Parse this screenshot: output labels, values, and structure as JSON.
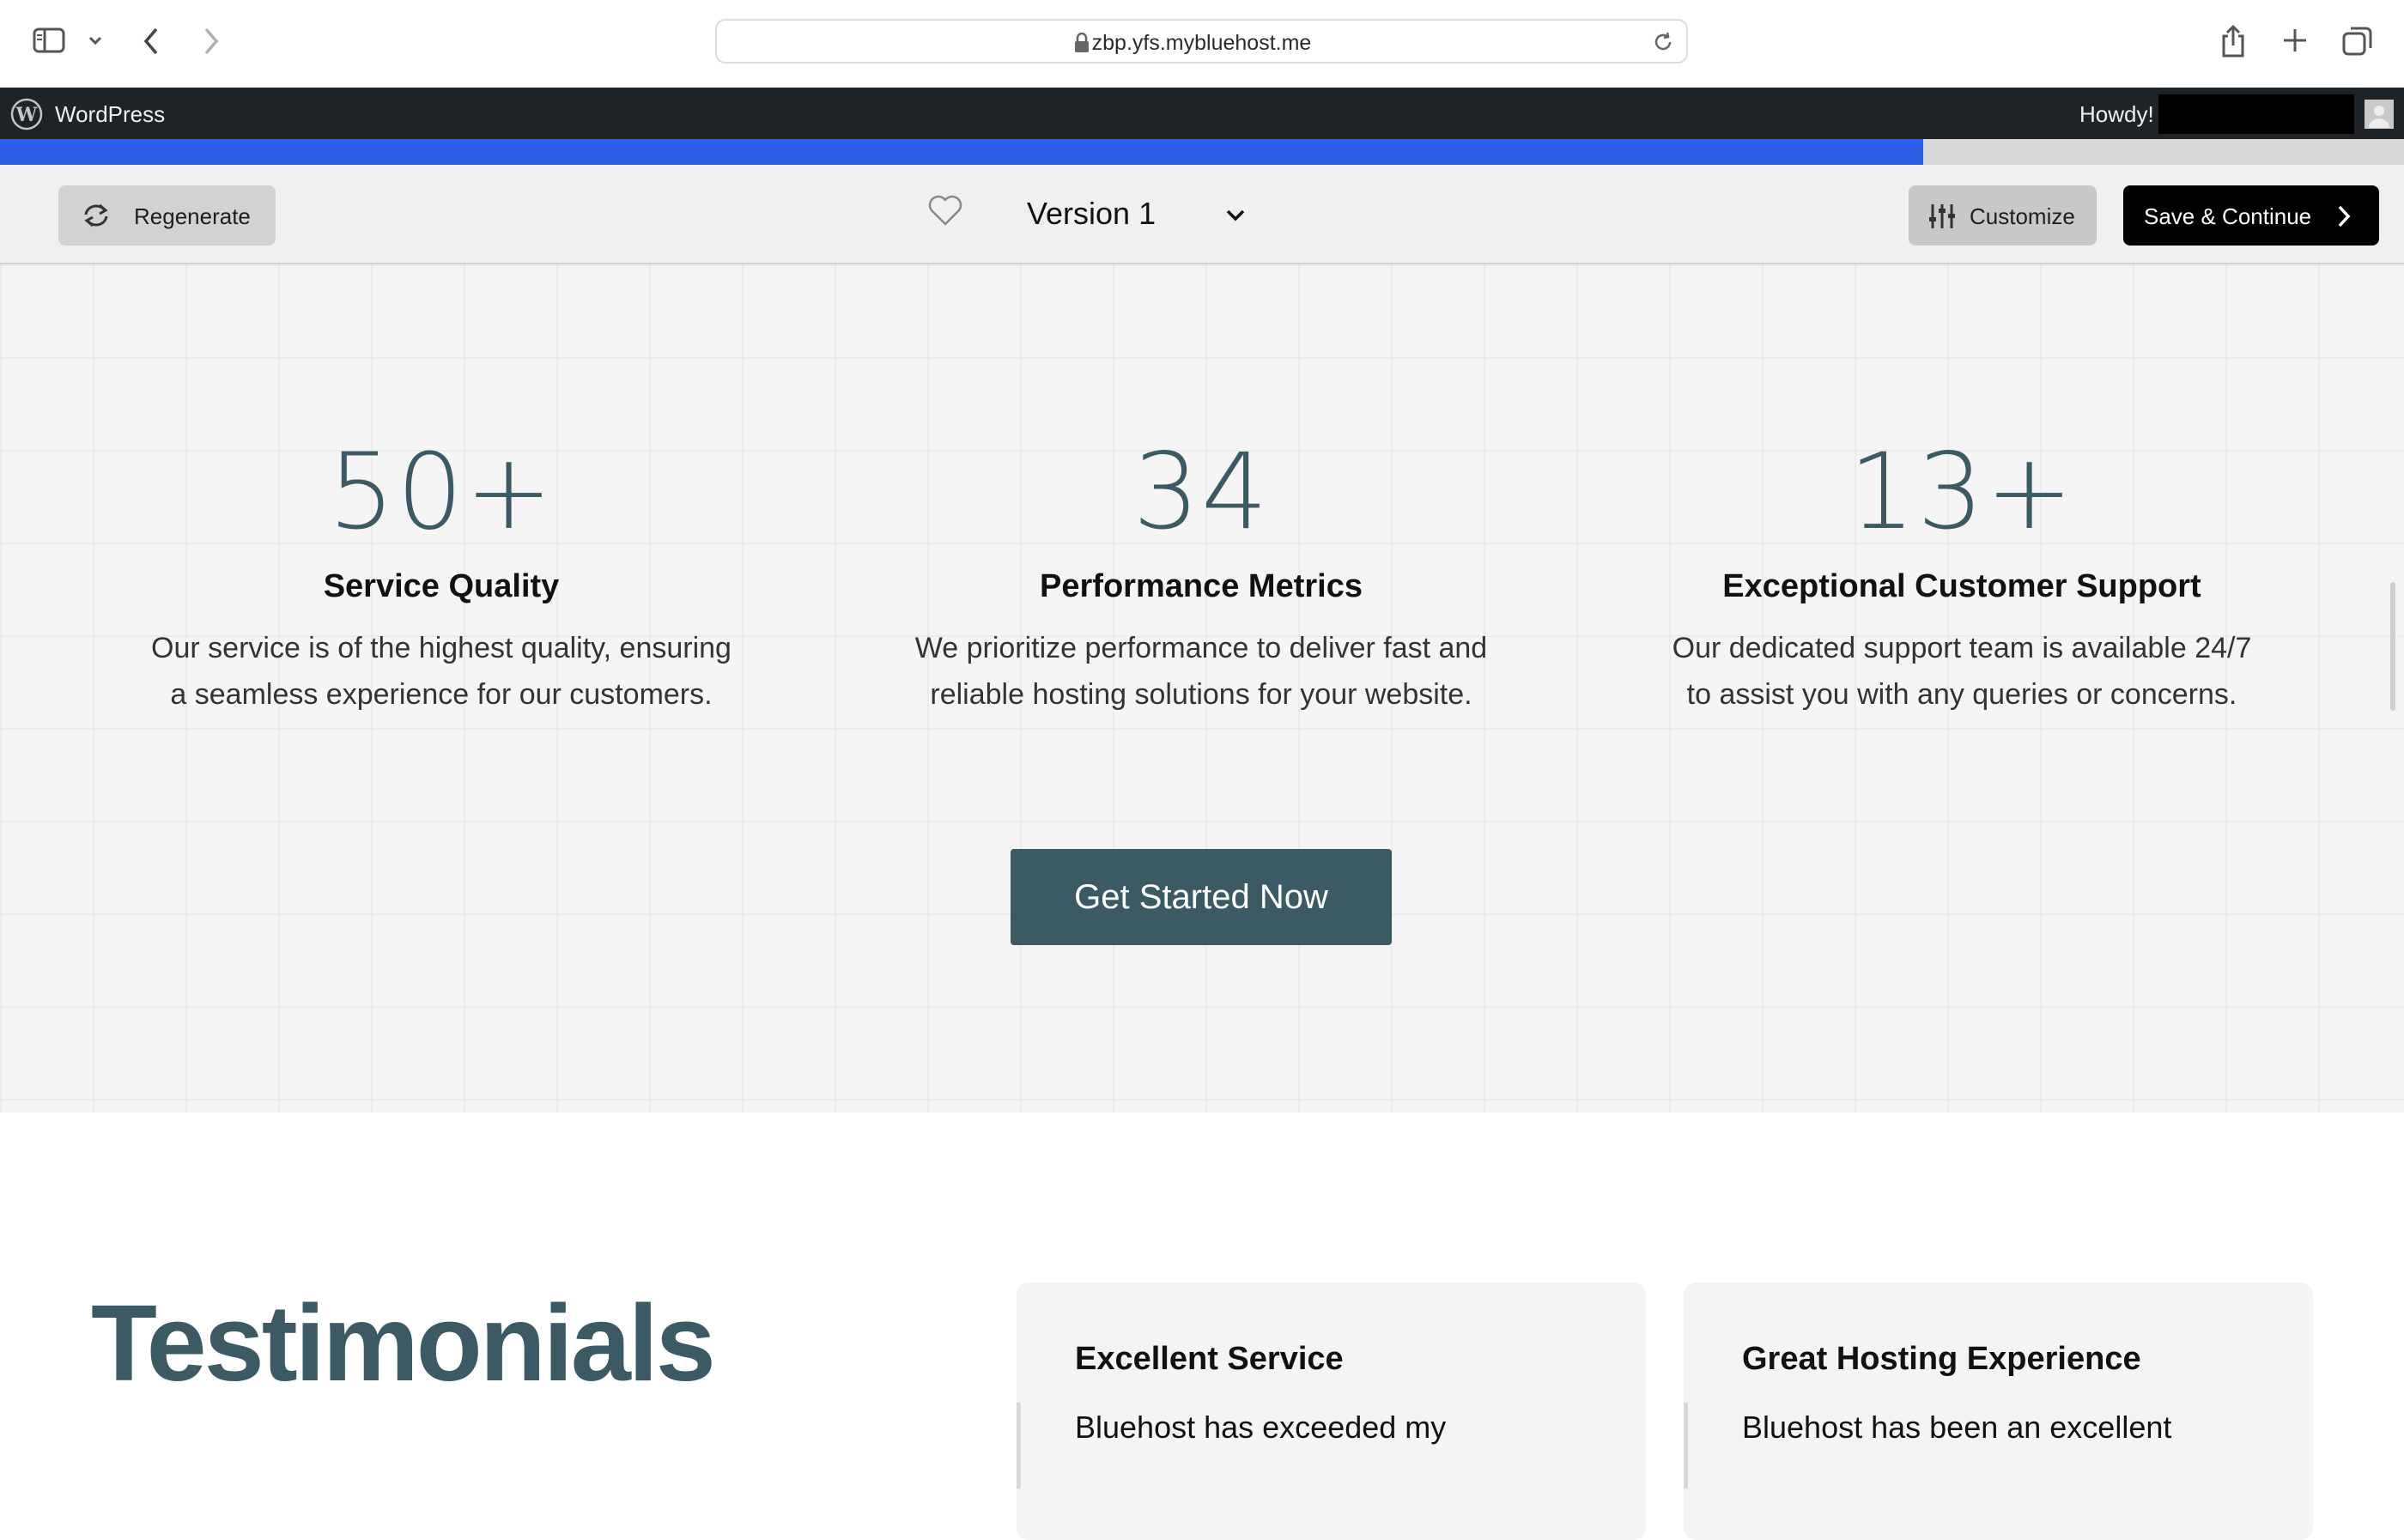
{
  "browser": {
    "url": "zbp.yfs.mybluehost.me"
  },
  "wp_admin_bar": {
    "site_label": "WordPress",
    "howdy": "Howdy!"
  },
  "progress": {
    "fraction": 0.8
  },
  "toolbar": {
    "regenerate_label": "Regenerate",
    "version_label": "Version 1",
    "customize_label": "Customize",
    "save_label": "Save & Continue"
  },
  "stats": [
    {
      "number": "50+",
      "title": "Service Quality",
      "desc_line1": "Our service is of the highest quality, ensuring",
      "desc_line2": "a seamless experience for our customers."
    },
    {
      "number": "34",
      "title": "Performance Metrics",
      "desc_line1": "We prioritize performance to deliver fast and",
      "desc_line2": "reliable hosting solutions for your website."
    },
    {
      "number": "13+",
      "title": "Exceptional Customer Support",
      "desc_line1": "Our dedicated support team is available 24/7",
      "desc_line2": "to assist you with any queries or concerns."
    }
  ],
  "cta_label": "Get Started Now",
  "testimonials": {
    "heading": "Testimonials",
    "cards": [
      {
        "title": "Excellent Service",
        "text": "Bluehost has exceeded my"
      },
      {
        "title": "Great Hosting Experience",
        "text": "Bluehost has been an excellent"
      }
    ]
  }
}
